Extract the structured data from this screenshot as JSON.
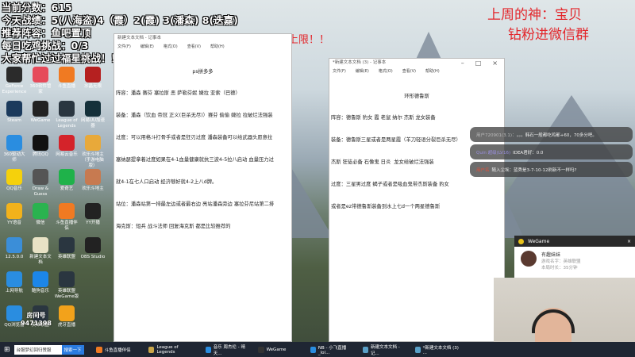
{
  "overlay": {
    "lines": [
      "当前分数：615",
      "今天战绩：5(八海盗)4（霞）2(霞) 3(潘森) 8(迭嘉)",
      "推荐阵容：鱼吧置顶",
      "每日吃鸡挑战：0/3",
      "大家帮忙过过福星挑战！！"
    ]
  },
  "banner": "今天双倍亲密度双倍上限！！",
  "top_right": [
    "上周的神：宝贝",
    "钻粉进微信群"
  ],
  "desktop_icons": [
    {
      "label": "GeForce Experience",
      "color": "#2b2b2b"
    },
    {
      "label": "360软件管家",
      "color": "#e64a5a"
    },
    {
      "label": "斗鱼直播",
      "color": "#f07a22"
    },
    {
      "label": "水晶无限",
      "color": "#b52020"
    },
    {
      "label": "Steam",
      "color": "#1b3a5c"
    },
    {
      "label": "WeGame",
      "color": "#222"
    },
    {
      "label": "League of Legends",
      "color": "#2a3640"
    },
    {
      "label": "网易UU加速器",
      "color": "#14303a"
    },
    {
      "label": "360驱动大师",
      "color": "#2a8de0"
    },
    {
      "label": "腾讯QQ",
      "color": "#111"
    },
    {
      "label": "网易云音乐",
      "color": "#d4232a"
    },
    {
      "label": "欢乐斗地主（手游电脑版）",
      "color": "#e8a93a"
    },
    {
      "label": "QQ音乐",
      "color": "#f5d10c"
    },
    {
      "label": "Draw & Guess",
      "color": "#555"
    },
    {
      "label": "爱奇艺",
      "color": "#1fb24a"
    },
    {
      "label": "欢乐斗地主",
      "color": "#c77a50"
    },
    {
      "label": "YY语音",
      "color": "#f2b21b"
    },
    {
      "label": "微信",
      "color": "#2ab34f"
    },
    {
      "label": "斗鱼直播伴侣",
      "color": "#f07a22"
    },
    {
      "label": "YY开播",
      "color": "#222"
    },
    {
      "label": "12.5.0.0",
      "color": "#3b8ed8"
    },
    {
      "label": "新建文本文档",
      "color": "#e8e2c5"
    },
    {
      "label": "英雄联盟",
      "color": "#2a3640"
    },
    {
      "label": "OBS Studio",
      "color": "#222"
    },
    {
      "label": "上网导航",
      "color": "#2a8de0"
    },
    {
      "label": "酷狗音乐",
      "color": "#1c86e8"
    },
    {
      "label": "英雄联盟WeGame版",
      "color": "#2a3640"
    },
    {
      "label": "",
      "color": "transparent"
    },
    {
      "label": "QQ浏览器",
      "color": "#2a8de0"
    },
    {
      "label": "英雄联盟",
      "color": "#2a3640"
    },
    {
      "label": "虎牙直播",
      "color": "#f2a21b"
    },
    {
      "label": "",
      "color": "transparent"
    }
  ],
  "room": {
    "label": "房间号",
    "number": "9471398"
  },
  "notepad1": {
    "title": "新建文本文档 - 记事本",
    "menu": [
      "文件(F)",
      "编辑(E)",
      "格式(O)",
      "查看(V)",
      "帮助(H)"
    ],
    "heading": "ps拼多多",
    "lines": [
      "阵容：潘森 赛芬 塞拉斯 恶 萨勒芬妮 婕拉 亚索（巴德）",
      "装备：潘森（饮血 帝冠 正义(巨杀无尽)）赛芬 偷偷 婕拉 拉破烂法强装",
      "过度：可以用格斗打骨手或者是狂刃过度 潘森装备可以给武器头愿意拉",
      "塞纳瑟提拿着过度如果在4-1血量健康就抗三波4-5拉八启动 血量压力过",
      "就4-1在七人口启动 经济够好就4-2上八d牌。",
      "站位：潘森站第一排最左边或者最右边 亮站潘森旁边 塞拉芬尼站第二排",
      "海克斯：短兵 战斗法师 回复海克斯 都是比较推荐的"
    ]
  },
  "notepad2": {
    "title": "*新建文本文档 (3) - 记事本",
    "menu": [
      "文件(F)",
      "编辑(E)",
      "格式(O)",
      "查看(V)",
      "帮助(H)"
    ],
    "heading": "环形德鲁斯",
    "lines": [
      "阵容：德鲁斯 豹女 霞 老鼠 纳尔 杰斯 龙女装备",
      "装备：德鲁斯三星或者是两星霞（羊刀轻语分裂巨杀无尽）",
      "杰斯 狂徒必备 石像鬼 日炎  龙女给破烂法强装",
      "过度：三星男过度 蝎子或者是吸血鬼带杰斯装备 豹女",
      "或者是ez带德鲁斯装备到水上七d一个两星德鲁斯"
    ]
  },
  "chat": [
    {
      "user": "用户720901(3.1)：",
      "text": "。。。韩石一般都吃鸡都+60，70多分吧。"
    },
    {
      "user": "Quin 超级(LV16)",
      "text": "IDEA君好：0.0"
    },
    {
      "user": "用户名",
      "text": "随入尘埃：蓝秀是3-7-10-12刷新不一样吗?"
    }
  ],
  "wegame": {
    "title": "WeGame",
    "name": "有趣妹妹",
    "game": "游戏名字：英雄联盟",
    "time": "本局时长：35分钟"
  },
  "taskbar": {
    "search": "台服梦幻回归赞服",
    "search_btn": "搜索一下",
    "items": [
      "斗鱼直播伴侣",
      "League of Legends",
      "音乐 周杰伦 - 晴天...",
      "WeGame",
      "NB - 小飞直播_lol...",
      "新建文本文档 - 记...",
      "*新建文本文档 (3) ..."
    ],
    "colors": [
      "#f07a22",
      "#c9a64a",
      "#2a8de0",
      "#333",
      "#2a8de0",
      "#5aa0c8",
      "#5aa0c8"
    ]
  }
}
